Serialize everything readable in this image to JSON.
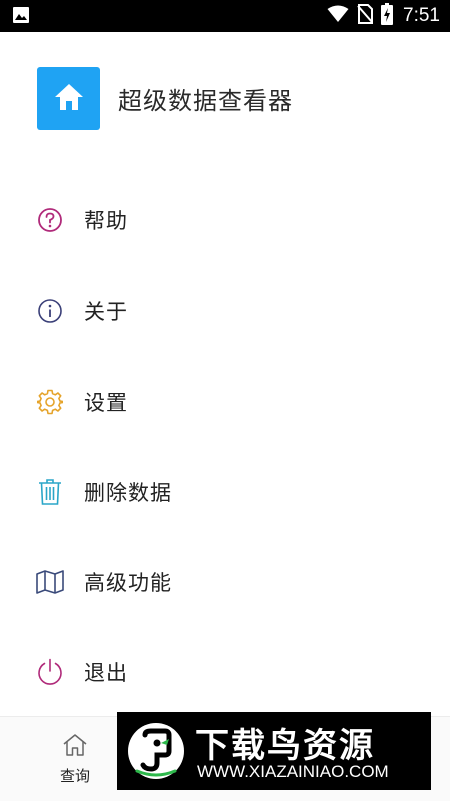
{
  "status_bar": {
    "time": "7:51",
    "icons": [
      "image-icon",
      "wifi-icon",
      "no-sim-icon",
      "battery-charging-icon"
    ]
  },
  "header": {
    "title": "超级数据查看器",
    "logo_icon": "home-icon",
    "logo_color": "#1fa3f3"
  },
  "menu": {
    "items": [
      {
        "label": "帮助",
        "icon": "help-icon",
        "color": "#b02a7a"
      },
      {
        "label": "关于",
        "icon": "info-icon",
        "color": "#3a3f78"
      },
      {
        "label": "设置",
        "icon": "gear-icon",
        "color": "#e5a32a"
      },
      {
        "label": "删除数据",
        "icon": "trash-icon",
        "color": "#2aa6c8"
      },
      {
        "label": "高级功能",
        "icon": "map-icon",
        "color": "#3a4a7a"
      },
      {
        "label": "退出",
        "icon": "power-icon",
        "color": "#b02a7a"
      }
    ]
  },
  "bottom_nav": {
    "items": [
      {
        "label": "查询",
        "icon": "home-outline-icon"
      }
    ]
  },
  "watermark": {
    "title": "下载鸟资源",
    "url": "WWW.XIAZAINIAO.COM"
  }
}
